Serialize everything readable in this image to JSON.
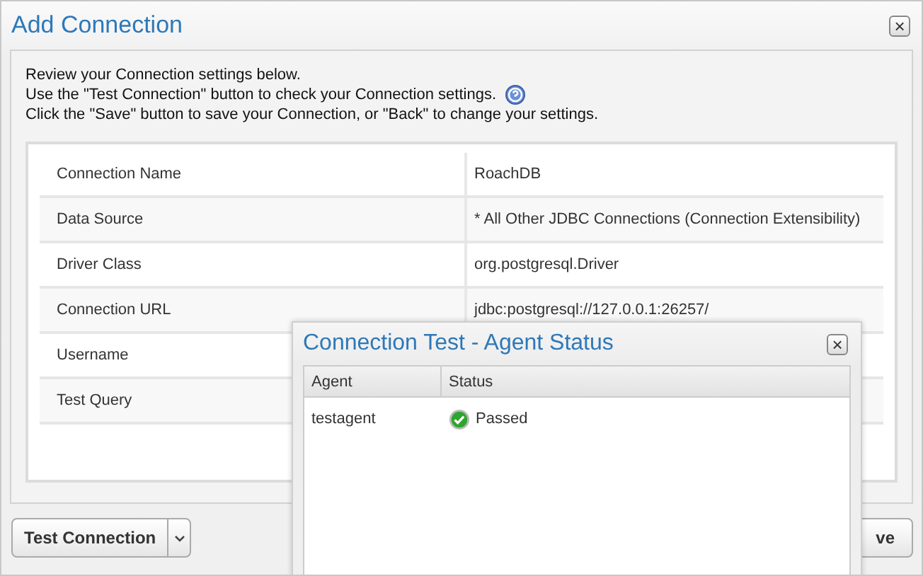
{
  "window": {
    "title": "Add Connection",
    "close": "×"
  },
  "intro": [
    "Review your Connection settings below.",
    "Use the \"Test Connection\" button to check your Connection settings.",
    "Click the \"Save\" button to save your Connection, or \"Back\" to change your settings."
  ],
  "settings": [
    {
      "label": "Connection Name",
      "value": "RoachDB"
    },
    {
      "label": "Data Source",
      "value": "* All Other JDBC Connections (Connection Extensibility)"
    },
    {
      "label": "Driver Class",
      "value": "org.postgresql.Driver"
    },
    {
      "label": "Connection URL",
      "value": "jdbc:postgresql://127.0.0.1:26257/"
    },
    {
      "label": "Username"
    },
    {
      "label": "Test Query"
    }
  ],
  "buttons": {
    "test": "Test Connection",
    "save": "ve"
  },
  "agent_dialog": {
    "title": "Connection Test - Agent Status",
    "close": "×",
    "columns": [
      "Agent",
      "Status"
    ],
    "rows": [
      {
        "agent": "testagent",
        "status": "Passed",
        "kind": "passed"
      }
    ]
  }
}
